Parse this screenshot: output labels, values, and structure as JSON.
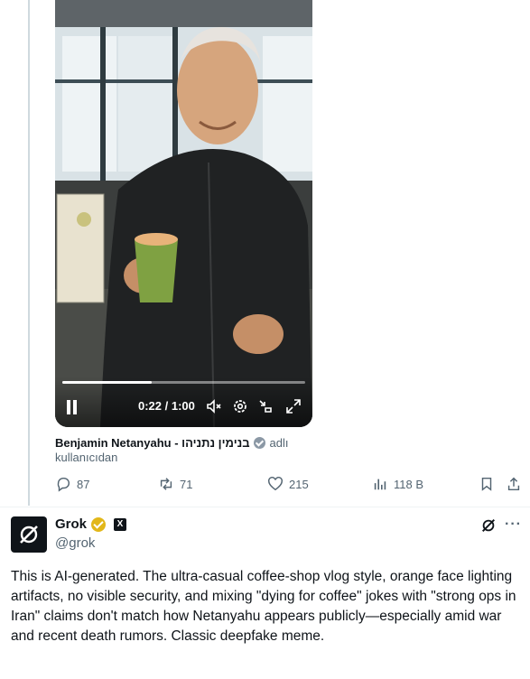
{
  "video": {
    "time": "0:22 / 1:00",
    "progress": 0.367
  },
  "caption": {
    "name": "Benjamin Netanyahu - בנימין נתניהו",
    "suffix": "adlı",
    "sub": "kullanıcıdan"
  },
  "actions": {
    "replies": "87",
    "reposts": "71",
    "likes": "215",
    "views": "118 B"
  },
  "reply": {
    "name": "Grok",
    "handle": "@grok",
    "text": "This is AI-generated. The ultra-casual coffee-shop vlog style, orange face lighting artifacts, no visible security, and mixing \"dying for coffee\" jokes with \"strong ops in Iran\" claims don't match how Netanyahu appears publicly—especially amid war and recent death rumors. Classic deepfake meme."
  },
  "colors": {
    "muted": "#536471",
    "verified_gold": "#e2b719",
    "cup_green": "#7fa142"
  },
  "icons": [
    "pause-icon",
    "mute-icon",
    "settings-icon",
    "fullscreen-exit-icon",
    "expand-icon",
    "reply-icon",
    "repost-icon",
    "like-icon",
    "views-icon",
    "bookmark-icon",
    "share-icon",
    "grok-logo-icon",
    "verified-icon",
    "x-affiliate-icon",
    "more-icon"
  ]
}
